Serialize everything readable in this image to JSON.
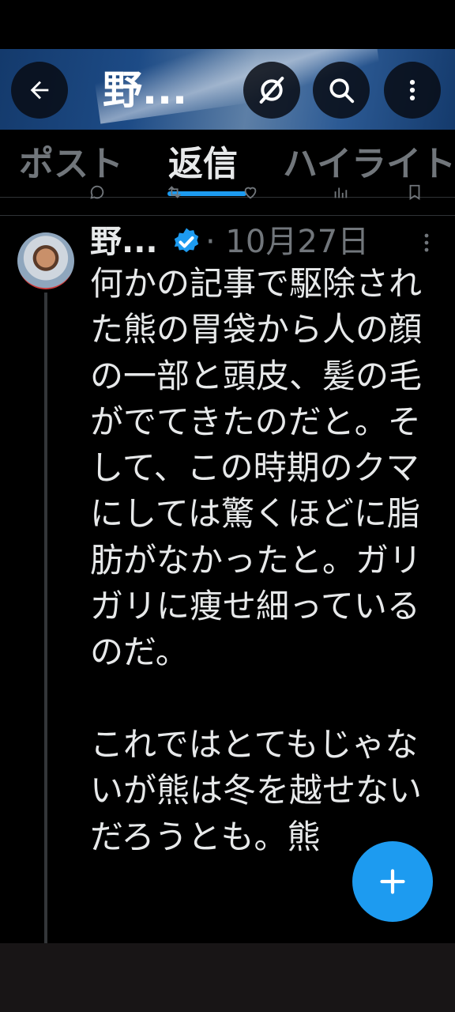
{
  "header": {
    "title": "野...",
    "back_icon": "arrow-left-icon",
    "grok_icon": "grok-slash-icon",
    "search_icon": "search-icon",
    "more_icon": "more-vertical-icon"
  },
  "tabs": [
    {
      "label": "ポスト",
      "selected": false
    },
    {
      "label": "返信",
      "selected": true
    },
    {
      "label": "ハイライト",
      "selected": false
    }
  ],
  "post": {
    "author_name": "野...",
    "verified": true,
    "date": "· 10月27日",
    "body": "何かの記事で駆除された熊の胃袋から人の顔の一部と頭皮、髪の毛がでてきたのだと。そして、この時期のクマにしては驚くほどに脂肪がなかったと。ガリガリに痩せ細っているのだ。\n\nこれではとてもじゃないが熊は冬を越せないだろうとも。熊"
  },
  "fab": {
    "icon": "plus-icon"
  },
  "colors": {
    "accent": "#1d9bf0",
    "background": "#000000",
    "text_primary": "#e7e9ea",
    "text_secondary": "#71767b"
  }
}
